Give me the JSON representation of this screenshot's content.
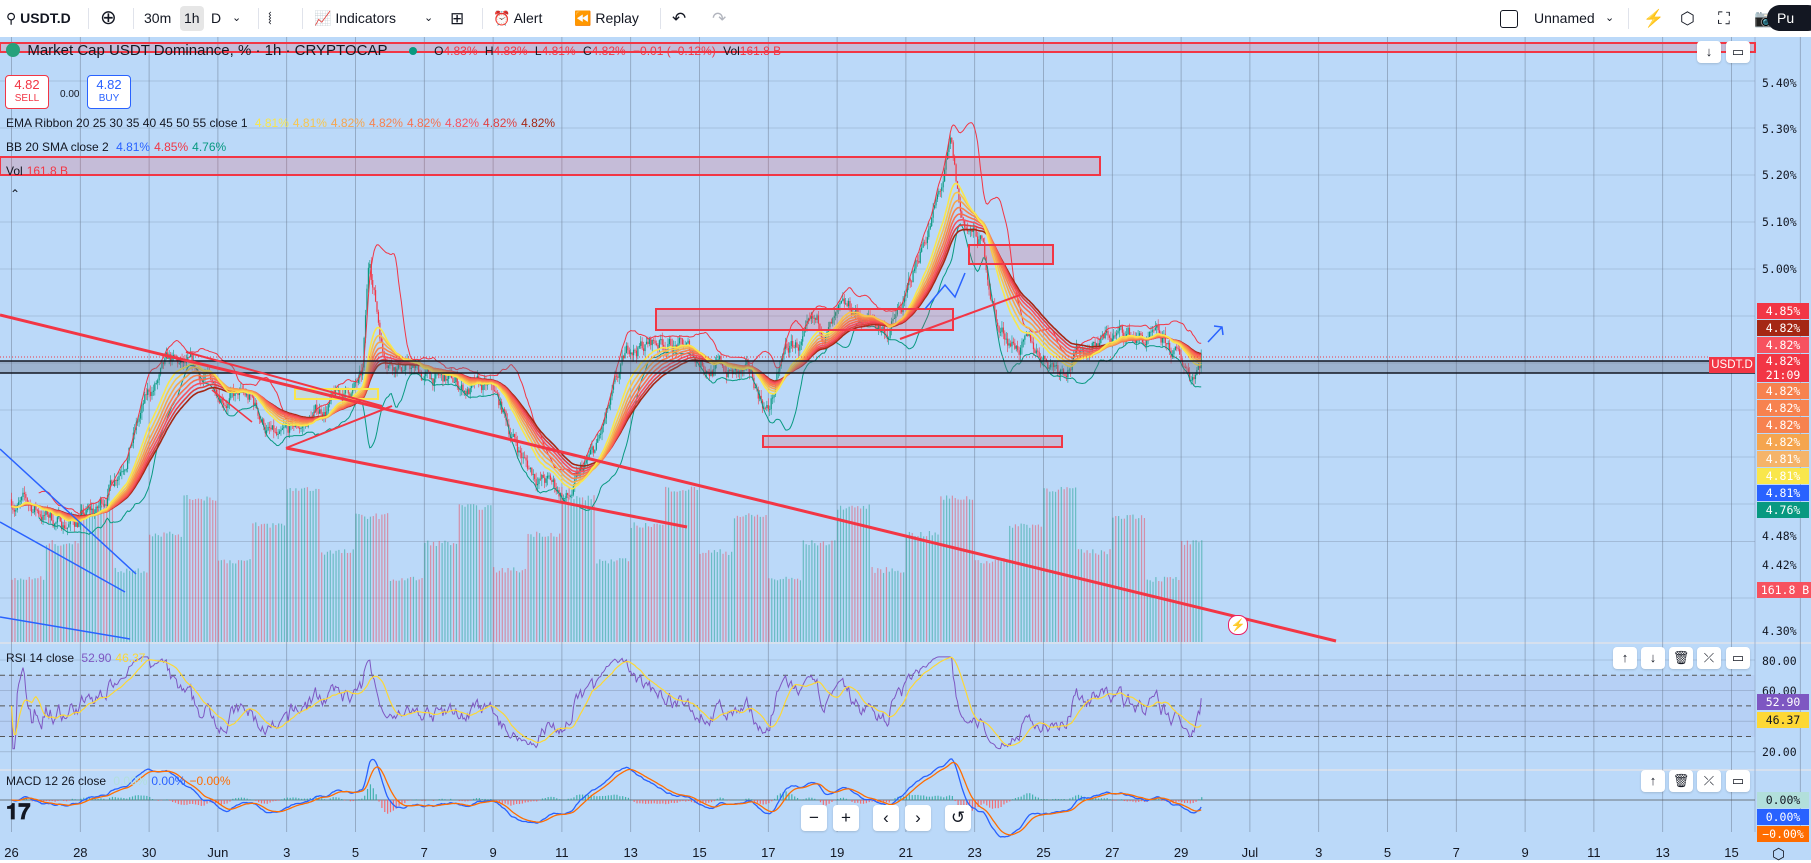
{
  "toolbar": {
    "symbol": "USDT.D",
    "intervals": [
      "30m",
      "1h",
      "D"
    ],
    "selected_interval": "1h",
    "indicators_label": "Indicators",
    "alert_label": "Alert",
    "replay_label": "Replay",
    "layout_name": "Unnamed",
    "publish_label": "Pu",
    "icons": [
      "search-icon",
      "add-symbol-icon",
      "chevron-down-icon",
      "candles-icon",
      "indicators-icon",
      "templates-icon",
      "alarm-icon",
      "replay-icon",
      "undo-icon",
      "redo-icon",
      "checkbox-icon",
      "quick-search-icon",
      "settings-icon",
      "fullscreen-icon",
      "camera-icon"
    ]
  },
  "legend": {
    "title": "Market Cap USDT Dominance, % · 1h · CRYPTOCAP",
    "ohlc": {
      "o_label": "O",
      "o": "4.83%",
      "h_label": "H",
      "h": "4.83%",
      "l_label": "L",
      "l": "4.81%",
      "c_label": "C",
      "c": "4.82%",
      "change": "−0.01 (−0.12%)",
      "vol_label": "Vol",
      "vol": "161.8 B"
    },
    "sell_price": "4.82",
    "sell_label": "SELL",
    "spread": "0.00",
    "buy_price": "4.82",
    "buy_label": "BUY",
    "ema_ribbon": {
      "label": "EMA Ribbon 20 25 30 35 40 45 50 55 close 1",
      "values": [
        "4.81%",
        "4.81%",
        "4.82%",
        "4.82%",
        "4.82%",
        "4.82%",
        "4.82%",
        "4.82%"
      ]
    },
    "bb": {
      "label": "BB 20 SMA close 2",
      "values": [
        "4.81%",
        "4.85%",
        "4.76%"
      ]
    },
    "vol": {
      "label": "Vol",
      "value": "161.8 B"
    },
    "rsi": {
      "label": "RSI 14 close",
      "values": [
        "52.90",
        "46.37"
      ]
    },
    "macd": {
      "label": "MACD 12 26 close",
      "values": [
        "0.00%",
        "0.00%",
        "−0.00%"
      ]
    }
  },
  "price_axis": {
    "labels": [
      "5.40%",
      "5.30%",
      "5.20%",
      "5.10%",
      "5.00%",
      "4.48%",
      "4.42%",
      "4.30%"
    ],
    "badges": [
      {
        "text": "4.85%",
        "color": "#f23645"
      },
      {
        "text": "4.82%",
        "color": "#a52714"
      },
      {
        "text": "4.82%",
        "color": "#f7525f"
      },
      {
        "text": "4.82%\n21:09",
        "color": "#f23645"
      },
      {
        "text": "4.82%",
        "color": "#f7824f"
      },
      {
        "text": "4.82%",
        "color": "#f7824f"
      },
      {
        "text": "4.82%",
        "color": "#f7824f"
      },
      {
        "text": "4.82%",
        "color": "#f5a54f"
      },
      {
        "text": "4.81%",
        "color": "#f5b46a"
      },
      {
        "text": "4.81%",
        "color": "#f9e64b"
      },
      {
        "text": "4.81%",
        "color": "#2962ff"
      },
      {
        "text": "4.76%",
        "color": "#089981"
      }
    ],
    "symbol_tag": "USDT.D",
    "volume_badge": "161.8 B",
    "rsi_labels": [
      "80.00",
      "60.00",
      "20.00"
    ],
    "rsi_badges": [
      {
        "text": "52.90",
        "color": "#7e57c2"
      },
      {
        "text": "46.37",
        "color": "#fdd835"
      }
    ],
    "macd_badges": [
      {
        "text": "0.00%",
        "color": "#b2dfdb"
      },
      {
        "text": "0.00%",
        "color": "#2962ff"
      },
      {
        "text": "−0.00%",
        "color": "#ff6d00"
      }
    ]
  },
  "time_axis": {
    "labels": [
      "26",
      "28",
      "30",
      "Jun",
      "3",
      "5",
      "7",
      "9",
      "11",
      "13",
      "15",
      "17",
      "19",
      "21",
      "23",
      "25",
      "27",
      "29",
      "Jul",
      "3",
      "5",
      "7",
      "9",
      "11",
      "13",
      "15"
    ]
  },
  "nav_buttons": [
    "−",
    "+",
    "‹",
    "›",
    "↺"
  ],
  "colors": {
    "up": "#089981",
    "down": "#f23645",
    "drawing": "#f23645",
    "background": "#bbd9f9",
    "ema": [
      "#f9e64b",
      "#f7c64f",
      "#f5a54f",
      "#f7824f",
      "#f7704f",
      "#f7525f",
      "#e04040",
      "#a52714"
    ],
    "bb_upper": "#f23645",
    "bb_lower": "#089981",
    "rsi": "#7e57c2",
    "rsi_ma": "#fdd835",
    "macd": "#2962ff",
    "signal": "#ff6d00"
  },
  "chart_data": {
    "type": "candlestick",
    "x_unit": "days since May 26 (hourly candles)",
    "price_path": [
      [
        0,
        4.51
      ],
      [
        1.5,
        4.46
      ],
      [
        2.5,
        4.48
      ],
      [
        4,
        4.73
      ],
      [
        4.6,
        4.79
      ],
      [
        6,
        4.75
      ],
      [
        7,
        4.71
      ],
      [
        7.8,
        4.62
      ],
      [
        9,
        4.7
      ],
      [
        10.2,
        4.76
      ],
      [
        10.4,
        5.02
      ],
      [
        10.8,
        4.83
      ],
      [
        12,
        4.77
      ],
      [
        14,
        4.73
      ],
      [
        15,
        4.58
      ],
      [
        16.2,
        4.51
      ],
      [
        17,
        4.61
      ],
      [
        18,
        4.83
      ],
      [
        19,
        4.85
      ],
      [
        20,
        4.81
      ],
      [
        21.5,
        4.76
      ],
      [
        22,
        4.7
      ],
      [
        22.5,
        4.82
      ],
      [
        23.5,
        4.86
      ],
      [
        24.5,
        4.9
      ],
      [
        25.5,
        4.87
      ],
      [
        26,
        4.93
      ],
      [
        26.5,
        5.06
      ],
      [
        27,
        5.16
      ],
      [
        27.3,
        5.25
      ],
      [
        27.6,
        5.1
      ],
      [
        28.2,
        5.05
      ],
      [
        28.7,
        4.87
      ],
      [
        29.5,
        4.83
      ],
      [
        30.5,
        4.8
      ],
      [
        31.5,
        4.85
      ],
      [
        32.5,
        4.86
      ],
      [
        33.5,
        4.83
      ],
      [
        34.3,
        4.78
      ],
      [
        34.6,
        4.82
      ]
    ],
    "last_close": 4.82
  }
}
